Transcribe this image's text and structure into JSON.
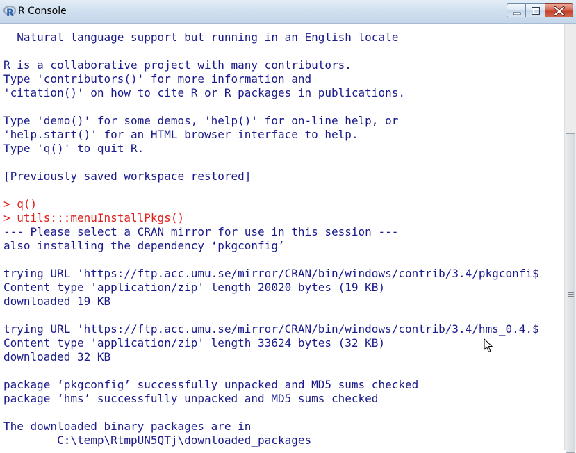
{
  "window": {
    "title": "R Console",
    "logo_letter": "R"
  },
  "console": {
    "lines": [
      {
        "text": "  Natural language support but running in an English locale",
        "kind": "output"
      },
      {
        "text": "",
        "kind": "output"
      },
      {
        "text": "R is a collaborative project with many contributors.",
        "kind": "output"
      },
      {
        "text": "Type 'contributors()' for more information and",
        "kind": "output"
      },
      {
        "text": "'citation()' on how to cite R or R packages in publications.",
        "kind": "output"
      },
      {
        "text": "",
        "kind": "output"
      },
      {
        "text": "Type 'demo()' for some demos, 'help()' for on-line help, or",
        "kind": "output"
      },
      {
        "text": "'help.start()' for an HTML browser interface to help.",
        "kind": "output"
      },
      {
        "text": "Type 'q()' to quit R.",
        "kind": "output"
      },
      {
        "text": "",
        "kind": "output"
      },
      {
        "text": "[Previously saved workspace restored]",
        "kind": "output"
      },
      {
        "text": "",
        "kind": "output"
      },
      {
        "text": "> q()",
        "kind": "cmd"
      },
      {
        "text": "> utils:::menuInstallPkgs()",
        "kind": "cmd"
      },
      {
        "text": "--- Please select a CRAN mirror for use in this session ---",
        "kind": "output"
      },
      {
        "text": "also installing the dependency ‘pkgconfig’",
        "kind": "output"
      },
      {
        "text": "",
        "kind": "output"
      },
      {
        "text": "trying URL 'https://ftp.acc.umu.se/mirror/CRAN/bin/windows/contrib/3.4/pkgconfi$",
        "kind": "output"
      },
      {
        "text": "Content type 'application/zip' length 20020 bytes (19 KB)",
        "kind": "output"
      },
      {
        "text": "downloaded 19 KB",
        "kind": "output"
      },
      {
        "text": "",
        "kind": "output"
      },
      {
        "text": "trying URL 'https://ftp.acc.umu.se/mirror/CRAN/bin/windows/contrib/3.4/hms_0.4.$",
        "kind": "output"
      },
      {
        "text": "Content type 'application/zip' length 33624 bytes (32 KB)",
        "kind": "output"
      },
      {
        "text": "downloaded 32 KB",
        "kind": "output"
      },
      {
        "text": "",
        "kind": "output"
      },
      {
        "text": "package ‘pkgconfig’ successfully unpacked and MD5 sums checked",
        "kind": "output"
      },
      {
        "text": "package ‘hms’ successfully unpacked and MD5 sums checked",
        "kind": "output"
      },
      {
        "text": "",
        "kind": "output"
      },
      {
        "text": "The downloaded binary packages are in",
        "kind": "output"
      },
      {
        "text": "        C:\\temp\\RtmpUN5QTj\\downloaded_packages",
        "kind": "output"
      }
    ]
  },
  "colors": {
    "output_text": "#1a1a8c",
    "command_text": "#e0201a",
    "background": "#ffffff"
  },
  "icons": {
    "app": "r-logo-icon",
    "minimize": "minimize-icon",
    "maximize": "maximize-icon",
    "close": "close-icon",
    "cursor": "mouse-pointer-icon"
  }
}
